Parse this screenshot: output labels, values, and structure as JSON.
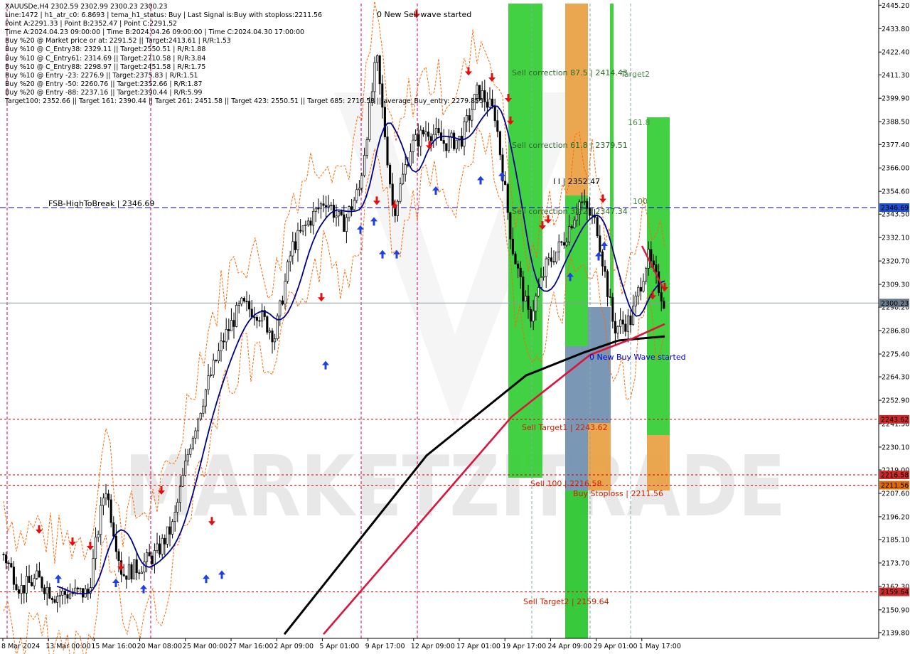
{
  "header": {
    "symbol_line": "XAUUSDe,H4  2302.59 2302.99 2300.23 2300.23",
    "info_lines": [
      "Line:1472 | h1_atr_c0: 6.8693 | tema_h1_status: Buy | Last Signal is:Buy with stoploss:2211.56",
      "Point A:2291.33 | Point B:2352.47 | Point C:2291.52",
      "Time A:2024.04.23 09:00:00 | Time B:2024.04.26 09:00:00 | Time C:2024.04.30 17:00:00",
      "Buy %20 @ Market price or at: 2291.52 || Target:2413.61 | R/R:1.53",
      "Buy %10 @ C_Entry38: 2329.11 || Target:2550.51 | R/R:1.88",
      "Buy %10 @ C_Entry61: 2314.69 || Target:2710.58 | R/R:3.84",
      "Buy %10 @ C_Entry88: 2298.97 || Target:2451.58 | R/R:1.75",
      "Buy %10 @ Entry -23: 2276.9 || Target:2375.83 | R/R:1.51",
      "Buy %20 @ Entry -50: 2260.76 || Target:2352.66 | R/R:1.87",
      "Buy %20 @ Entry -88: 2237.16 || Target:2390.44 | R/R:5.99",
      "Target100: 2352.66 || Target 161: 2390.44 || Target 261: 2451.58 || Target 423: 2550.51 || Target 685: 2710.58 || average_Buy_entry: 2279.855"
    ]
  },
  "price_axis": {
    "ticks": [
      "2445.20",
      "2433.80",
      "2422.40",
      "2411.30",
      "2399.90",
      "2388.50",
      "2377.40",
      "2366.00",
      "2354.60",
      "2343.50",
      "2332.10",
      "2320.70",
      "2309.30",
      "2298.20",
      "2286.80",
      "2275.40",
      "2264.30",
      "2252.90",
      "2241.50",
      "2230.10",
      "2219.00",
      "2207.60",
      "2196.20",
      "2185.10",
      "2173.70",
      "2162.30",
      "2150.90",
      "2139.80"
    ],
    "current_price_label": "2300.23",
    "level_labels": [
      "2346.69",
      "2243.62",
      "2216.58",
      "2211.56",
      "2159.64"
    ]
  },
  "time_axis": {
    "labels": [
      "8 Mar 2024",
      "13 Mar 00:00",
      "15 Mar 16:00",
      "20 Mar 08:00",
      "25 Mar 00:00",
      "27 Mar 16:00",
      "2 Apr 09:00",
      "5 Apr 01:00",
      "9 Apr 17:00",
      "12 Apr 09:00",
      "17 Apr 01:00",
      "19 Apr 17:00",
      "24 Apr 09:00",
      "29 Apr 01:00",
      "1 May 17:00"
    ]
  },
  "annotations": {
    "sell_wave": "0 New Sell wave started",
    "buy_wave": "0 New Buy Wave started",
    "fsb": "FSB-HighToBreak | 2346.69",
    "sell_corr_875": "Sell correction 87.5 | 2414.43",
    "sell_corr_618": "Sell correction 61.8 | 2379.51",
    "sell_corr_382": "Sell correction 38.2 | 2347.34",
    "point_b": "I I | 2352.47",
    "target2": "Target2",
    "fib_1618": "161.8",
    "fib_100": "100",
    "sell_target1": "Sell Target1 | 2243.62",
    "sell_100": "Sell 100 | 2216.58",
    "buy_stoploss": "Buy Stoploss | 2211.56",
    "sell_target2": "Sell Target2 | 2159.64"
  },
  "watermark": "MARKETZITRADE",
  "colors": {
    "bull_candle": "#000000",
    "bear_candle": "#000000",
    "ma_fast": "#00008b",
    "ma_slow": "#000000",
    "ma_red": "#dc143c",
    "envelope": "#ff6600",
    "zone_green": "#32cd32",
    "zone_orange": "#e8a040",
    "zone_steel": "#6f8faf",
    "level_red": "#cc0000",
    "fsb_blue": "#0000cc",
    "arrow_up": "#1f3fe0",
    "arrow_down": "#e01010"
  },
  "chart_data": {
    "type": "candlestick",
    "symbol": "XAUUSDe",
    "timeframe": "H4",
    "ylim": [
      2137.0,
      2446.0
    ],
    "ohlc_last": {
      "open": 2302.59,
      "high": 2302.99,
      "low": 2300.23,
      "close": 2300.23
    },
    "key_prices": [
      {
        "x": "8 Mar 2024",
        "y": 2178
      },
      {
        "x": "12 Mar",
        "y": 2161
      },
      {
        "x": "13 Mar 00:00",
        "y": 2166
      },
      {
        "x": "15 Mar 16:00",
        "y": 2158
      },
      {
        "x": "18 Mar",
        "y": 2159
      },
      {
        "x": "20 Mar 08:00",
        "y": 2159
      },
      {
        "x": "21 Mar",
        "y": 2212
      },
      {
        "x": "22 Mar",
        "y": 2168
      },
      {
        "x": "25 Mar 00:00",
        "y": 2172
      },
      {
        "x": "26 Mar",
        "y": 2178
      },
      {
        "x": "27 Mar 16:00",
        "y": 2192
      },
      {
        "x": "28 Mar",
        "y": 2232
      },
      {
        "x": "1 Apr",
        "y": 2260
      },
      {
        "x": "2 Apr 09:00",
        "y": 2283
      },
      {
        "x": "3 Apr",
        "y": 2299
      },
      {
        "x": "4 Apr",
        "y": 2296
      },
      {
        "x": "5 Apr 01:00",
        "y": 2284
      },
      {
        "x": "7 Apr",
        "y": 2327
      },
      {
        "x": "8 Apr",
        "y": 2340
      },
      {
        "x": "9 Apr 17:00",
        "y": 2351
      },
      {
        "x": "10 Apr",
        "y": 2338
      },
      {
        "x": "11 Apr",
        "y": 2356
      },
      {
        "x": "12 Apr 09:00",
        "y": 2420
      },
      {
        "x": "12 Apr 20:00",
        "y": 2344
      },
      {
        "x": "15 Apr",
        "y": 2376
      },
      {
        "x": "16 Apr",
        "y": 2385
      },
      {
        "x": "17 Apr 01:00",
        "y": 2378
      },
      {
        "x": "18 Apr",
        "y": 2380
      },
      {
        "x": "19 Apr 00:00",
        "y": 2404
      },
      {
        "x": "19 Apr 17:00",
        "y": 2392
      },
      {
        "x": "22 Apr",
        "y": 2328
      },
      {
        "x": "23 Apr",
        "y": 2292
      },
      {
        "x": "24 Apr 09:00",
        "y": 2318
      },
      {
        "x": "25 Apr",
        "y": 2330
      },
      {
        "x": "26 Apr",
        "y": 2350
      },
      {
        "x": "29 Apr 01:00",
        "y": 2338
      },
      {
        "x": "30 Apr",
        "y": 2288
      },
      {
        "x": "30 Apr 17:00",
        "y": 2292
      },
      {
        "x": "1 May 17:00",
        "y": 2323
      },
      {
        "x": "2 May",
        "y": 2300
      }
    ],
    "horizontal_levels": [
      {
        "name": "FSB-HighToBreak",
        "price": 2346.69
      },
      {
        "name": "Sell Target1",
        "price": 2243.62
      },
      {
        "name": "Sell 100",
        "price": 2216.58
      },
      {
        "name": "Buy Stoploss",
        "price": 2211.56
      },
      {
        "name": "Sell Target2",
        "price": 2159.64
      },
      {
        "name": "current",
        "price": 2300.23
      }
    ]
  }
}
